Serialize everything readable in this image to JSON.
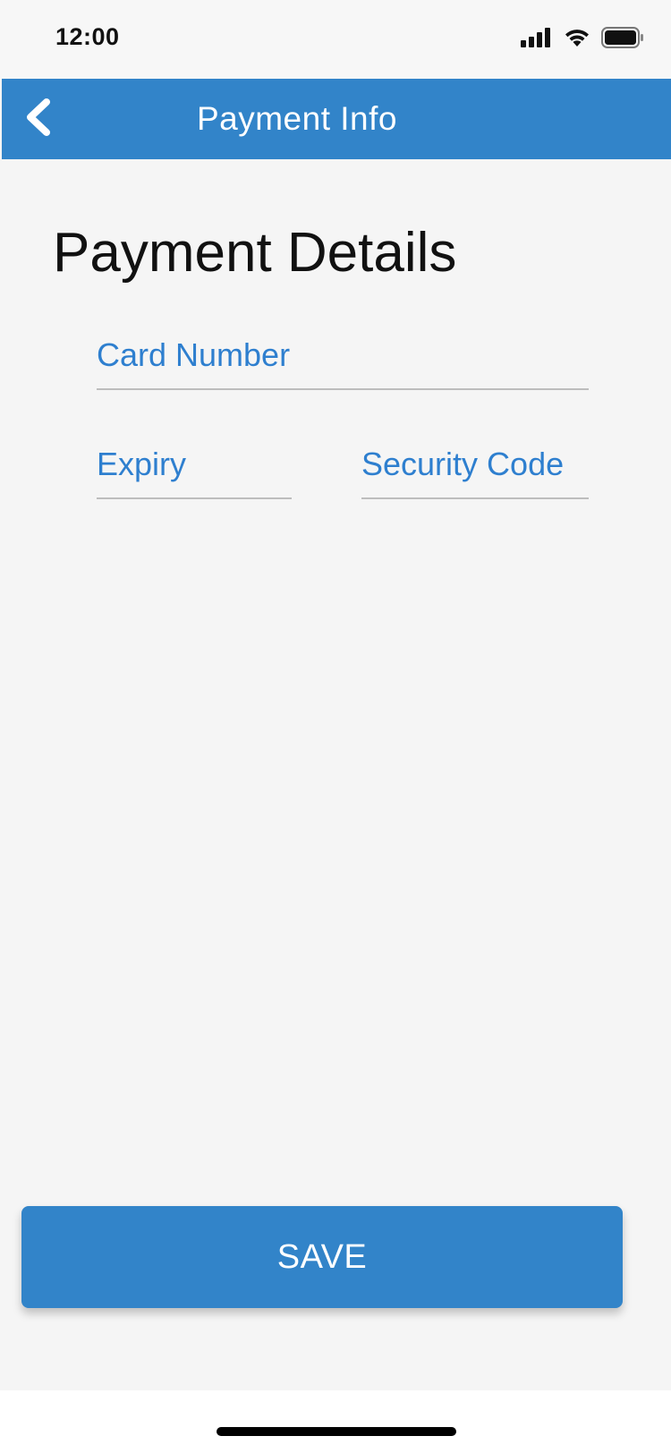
{
  "status_bar": {
    "time": "12:00",
    "icons": [
      "cellular-signal-icon",
      "wifi-icon",
      "battery-icon"
    ]
  },
  "app_bar": {
    "title": "Payment Info",
    "back_icon": "chevron-left-icon",
    "color": "#3284c9"
  },
  "content": {
    "title": "Payment Details",
    "fields": {
      "card_number": {
        "placeholder": "Card Number",
        "value": ""
      },
      "expiry": {
        "placeholder": "Expiry",
        "value": ""
      },
      "security_code": {
        "placeholder": "Security Code",
        "value": ""
      }
    }
  },
  "actions": {
    "save_label": "SAVE"
  },
  "colors": {
    "accent": "#3284c9",
    "placeholder": "#2e7fcf",
    "background": "#f5f5f5"
  }
}
